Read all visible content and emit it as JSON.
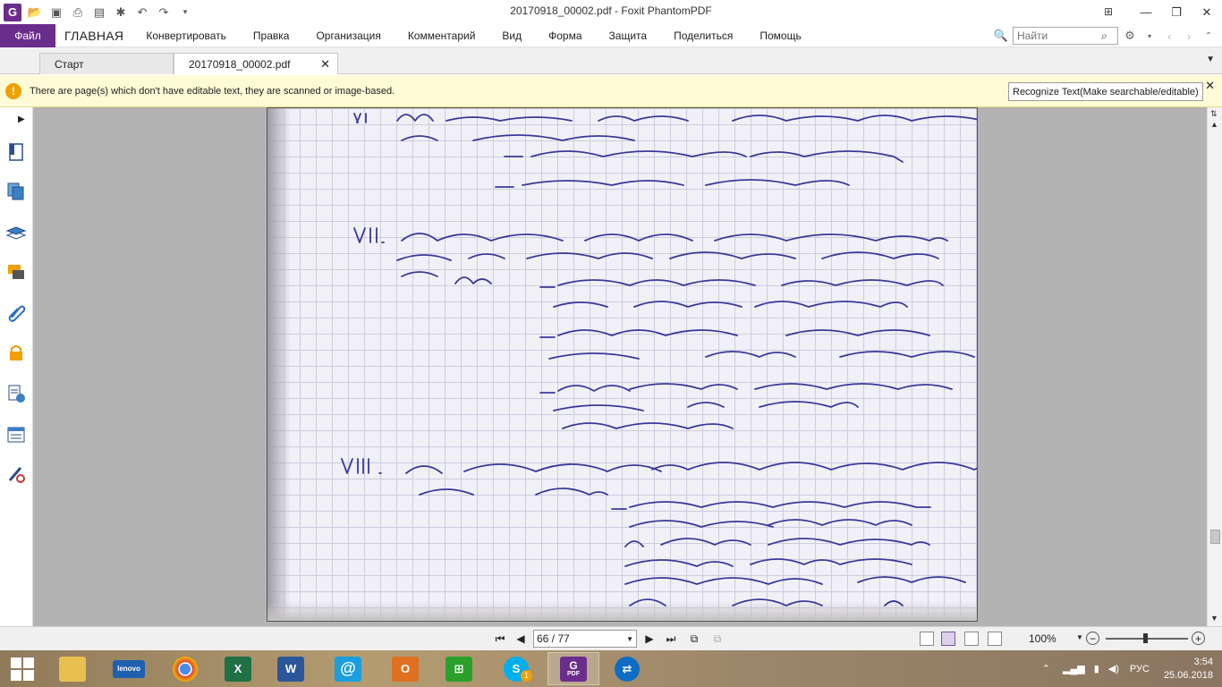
{
  "app": {
    "window_title": "20170918_00002.pdf - Foxit PhantomPDF"
  },
  "menu": {
    "file": "Файл",
    "items": [
      "ГЛАВНАЯ",
      "Конвертировать",
      "Правка",
      "Организация",
      "Комментарий",
      "Вид",
      "Форма",
      "Защита",
      "Поделиться",
      "Помощь"
    ],
    "search_placeholder": "Найти"
  },
  "tabs": [
    {
      "label": "Старт",
      "active": false
    },
    {
      "label": "20170918_00002.pdf",
      "active": true
    }
  ],
  "notification": {
    "message": "There are page(s) which don't have editable text, they are scanned or image-based.",
    "button": "Recognize Text(Make searchable/editable)"
  },
  "left_panel_icons": [
    "bookmark-icon",
    "pages-icon",
    "layers-icon",
    "comments-icon",
    "attachments-icon",
    "security-icon",
    "content-icon",
    "fields-icon",
    "signature-icon"
  ],
  "status": {
    "page_indicator": "66 / 77",
    "zoom": "100%"
  },
  "taskbar": {
    "apps": [
      "file-explorer",
      "lenovo",
      "chrome",
      "excel",
      "word",
      "mail",
      "outlook",
      "store",
      "skype",
      "foxit-pdf",
      "teamviewer"
    ],
    "active_app": "foxit-pdf",
    "lenovo_label": "lenovo",
    "pdf_label": "PDF",
    "skype_badge": "1",
    "language": "РУС",
    "time": "3:54",
    "date": "25.06.2018"
  },
  "colors": {
    "brand": "#6b2d8c",
    "notification_bg": "#fffbd6",
    "ink": "#39399a"
  }
}
